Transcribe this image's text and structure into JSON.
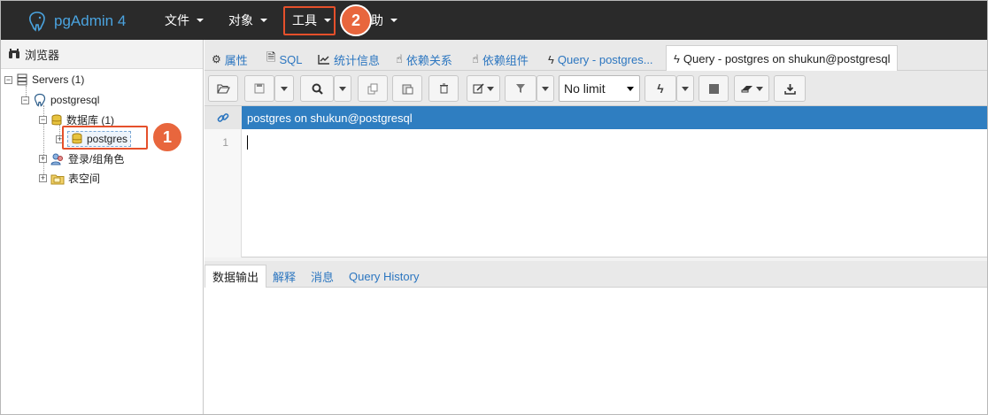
{
  "app": {
    "brand": "pgAdmin 4"
  },
  "navbar": {
    "menus": [
      {
        "label": "文件"
      },
      {
        "label": "对象"
      },
      {
        "label": "工具"
      },
      {
        "label": "助"
      }
    ]
  },
  "callouts": [
    "1",
    "2"
  ],
  "browser": {
    "title": "浏览器",
    "tree": {
      "servers": "Servers (1)",
      "server": "postgresql",
      "databases": "数据库 (1)",
      "database": "postgres",
      "roles": "登录/组角色",
      "tablespaces": "表空间"
    }
  },
  "tabs": [
    {
      "label": "属性",
      "icon": "gears-icon"
    },
    {
      "label": "SQL",
      "icon": "file-icon"
    },
    {
      "label": "统计信息",
      "icon": "line-chart-icon"
    },
    {
      "label": "依赖关系",
      "icon": "hand-icon"
    },
    {
      "label": "依赖组件",
      "icon": "hand-icon"
    },
    {
      "label": "Query - postgres...",
      "icon": "bolt-icon"
    },
    {
      "label": "Query - postgres on shukun@postgresql",
      "icon": "bolt-icon"
    }
  ],
  "toolbar": {
    "limit_select": "No limit"
  },
  "connection": {
    "label": "postgres on shukun@postgresql"
  },
  "editor": {
    "line_numbers": [
      "1"
    ]
  },
  "output_tabs": [
    {
      "label": "数据输出"
    },
    {
      "label": "解释"
    },
    {
      "label": "消息"
    },
    {
      "label": "Query History"
    }
  ],
  "colors": {
    "navbar_bg": "#2a2a2a",
    "brand": "#4aa3df",
    "accent_blue": "#2f7ec1",
    "link": "#2c76c0",
    "callout": "#e8663d"
  }
}
